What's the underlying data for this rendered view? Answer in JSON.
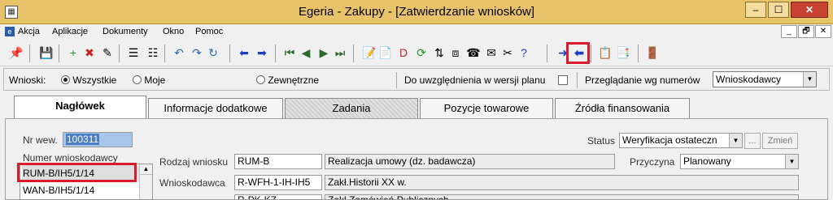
{
  "window": {
    "title": "Egeria - Zakupy - [Zatwierdzanie wniosków]",
    "app_icon": "egeria-app-icon",
    "controls": {
      "minimize": "–",
      "maximize": "☐",
      "close": "✕"
    }
  },
  "menu": {
    "items": [
      "Akcja",
      "Aplikacje",
      "Dokumenty",
      "Okno",
      "Pomoc"
    ],
    "mdi": {
      "minimize": "_",
      "restore": "🗗",
      "close": "✕"
    }
  },
  "toolbar": {
    "icons": [
      "pin-icon",
      "save-icon",
      "add-icon",
      "delete-icon",
      "edit-icon",
      "split-icon",
      "split2-icon",
      "undo-icon",
      "redo-icon",
      "refresh-icon",
      "arrow-left-icon",
      "arrow-right-icon",
      "first-icon",
      "prev-icon",
      "next-icon",
      "last-icon",
      "form-icon",
      "report-icon",
      "pdf-icon",
      "sync-icon",
      "sort-icon",
      "tree-icon",
      "phone-icon",
      "mail-icon",
      "tools-icon",
      "help-icon",
      "forward-icon",
      "back-icon",
      "doc-icon",
      "copy-icon",
      "exit-icon"
    ],
    "glyphs": [
      "📌",
      "💾",
      "+",
      "✖",
      "✎",
      "☰",
      "☷",
      "↶",
      "↷",
      "↻",
      "⬅",
      "➡",
      "⏮",
      "◀",
      "▶",
      "⏭",
      "📝",
      "📄",
      "D",
      "⟳",
      "⇅",
      "⧈",
      "☎",
      "✉",
      "✂",
      "?",
      "➜",
      "⬅",
      "📋",
      "📑",
      "🚪"
    ]
  },
  "filters": {
    "wnioski_label": "Wnioski:",
    "opt_all": "Wszystkie",
    "opt_mine": "Moje",
    "opt_external": "Zewnętrzne",
    "plan_label": "Do uwzględnienia w wersji planu",
    "browse_label": "Przeglądanie wg numerów",
    "browse_value": "Wnioskodawcy"
  },
  "tabs": [
    "Nagłówek",
    "Informacje dodatkowe",
    "Zadania",
    "Pozycje towarowe",
    "Źródła finansowania"
  ],
  "header": {
    "nrwew_label": "Nr wew.",
    "nrwew_value": "100311",
    "numer_label": "Numer wnioskodawcy",
    "list": [
      "RUM-B/IH5/1/14",
      "WAN-B/IH5/1/14"
    ],
    "status_label": "Status",
    "status_value": "Weryfikacja ostateczn",
    "ellipsis": "...",
    "change_button": "Zmień",
    "rodzaj_label": "Rodzaj wniosku",
    "rodzaj_code": "RUM-B",
    "rodzaj_desc": "Realizacja umowy (dz. badawcza)",
    "przyczyna_label": "Przyczyna",
    "przyczyna_value": "Planowany",
    "wnioskodawca_label": "Wnioskodawca",
    "wnioskodawca_code": "R-WFH-1-IH-IH5",
    "wnioskodawca_desc": "Zakł.Historii XX w.",
    "row3_code": "R-PK-KZ",
    "row3_desc": "Zakł.Zamówień Publicznych"
  }
}
